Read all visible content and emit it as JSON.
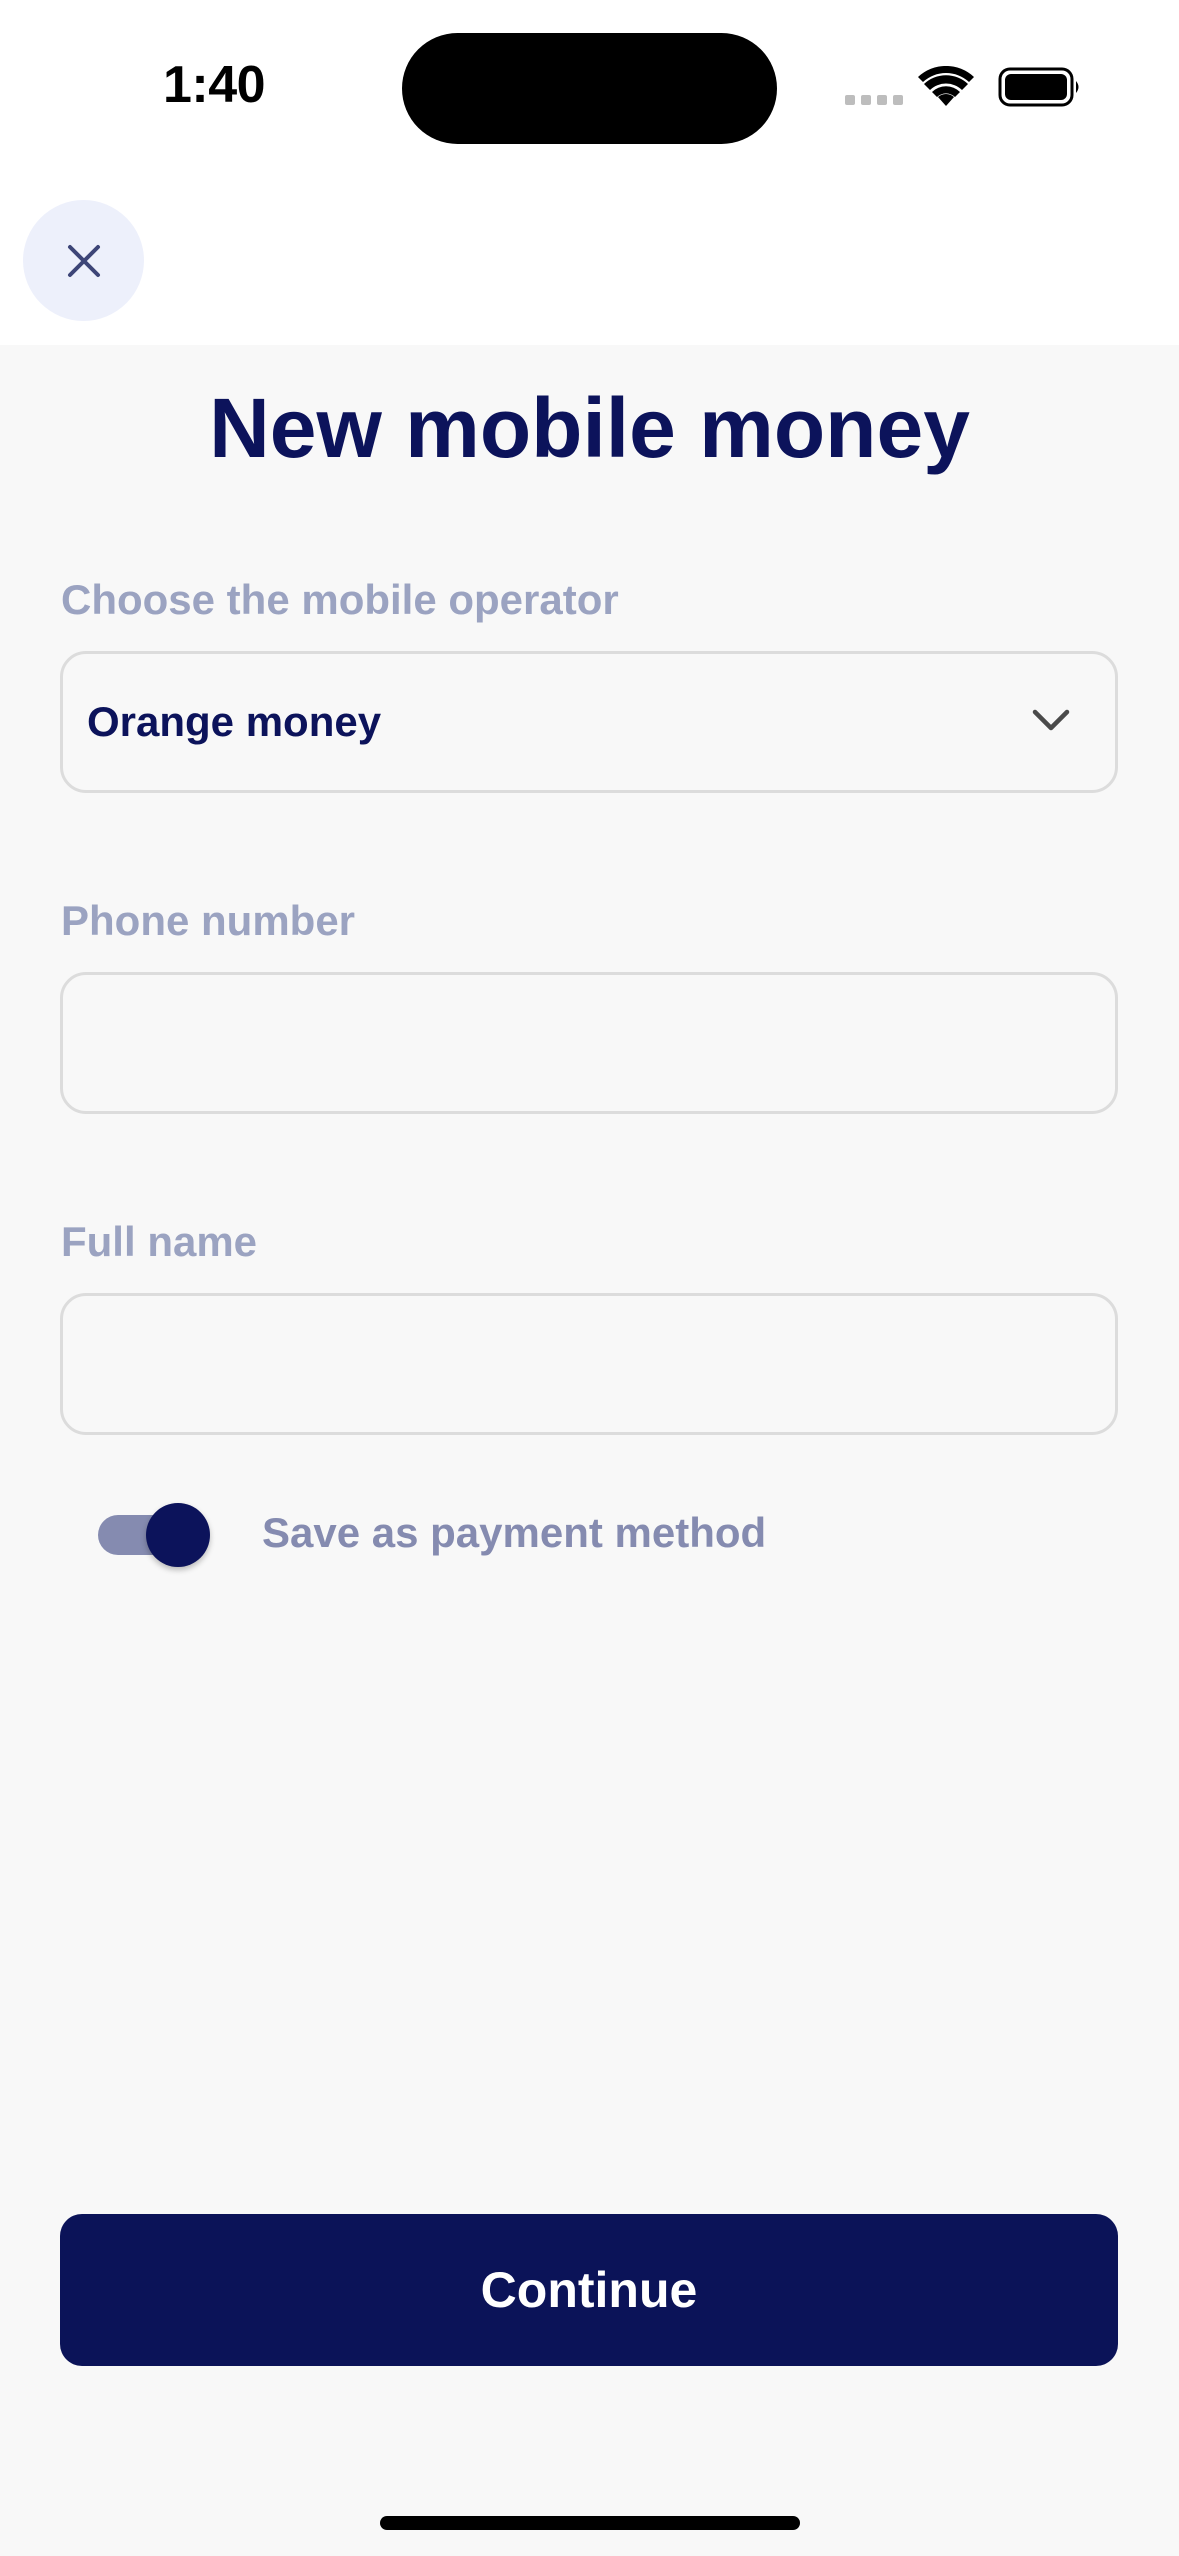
{
  "status_bar": {
    "time": "1:40"
  },
  "header": {
    "close_icon": "close-icon"
  },
  "main": {
    "title": "New mobile money",
    "operator": {
      "label": "Choose the mobile operator",
      "selected": "Orange money",
      "icon": "chevron-down-icon"
    },
    "phone": {
      "label": "Phone number",
      "value": ""
    },
    "full_name": {
      "label": "Full name",
      "value": ""
    },
    "save_toggle": {
      "label": "Save as payment method",
      "on": true
    }
  },
  "footer": {
    "continue_label": "Continue"
  },
  "colors": {
    "primary": "#0c135b",
    "label": "#9ba3c1",
    "close_bg": "#edf0fb",
    "background": "#f8f8f8"
  }
}
